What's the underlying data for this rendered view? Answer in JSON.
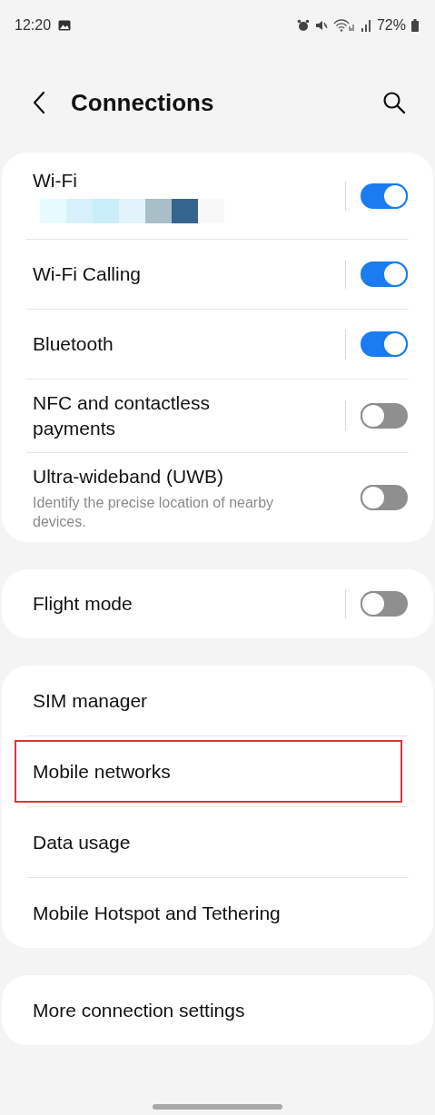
{
  "status_bar": {
    "time": "12:20",
    "battery": "72%"
  },
  "header": {
    "title": "Connections"
  },
  "groups": [
    {
      "items": [
        {
          "kind": "toggle",
          "label": "Wi-Fi",
          "redacted_subtitle": true,
          "separator": true,
          "on": true
        },
        {
          "kind": "toggle",
          "label": "Wi-Fi Calling",
          "separator": true,
          "on": true
        },
        {
          "kind": "toggle",
          "label": "Bluetooth",
          "separator": true,
          "on": true
        },
        {
          "kind": "toggle",
          "label": "NFC and contactless payments",
          "separator": true,
          "on": false
        },
        {
          "kind": "toggle",
          "label": "Ultra-wideband (UWB)",
          "description": "Identify the precise location of nearby devices.",
          "separator": false,
          "on": false
        }
      ]
    },
    {
      "items": [
        {
          "kind": "toggle",
          "label": "Flight mode",
          "separator": true,
          "on": false
        }
      ]
    },
    {
      "items": [
        {
          "kind": "link",
          "label": "SIM manager",
          "highlighted": false
        },
        {
          "kind": "link",
          "label": "Mobile networks",
          "highlighted": true
        },
        {
          "kind": "link",
          "label": "Data usage",
          "highlighted": false
        },
        {
          "kind": "link",
          "label": "Mobile Hotspot and Tethering",
          "highlighted": false
        }
      ]
    },
    {
      "items": [
        {
          "kind": "link",
          "label": "More connection settings",
          "highlighted": false
        }
      ]
    }
  ]
}
